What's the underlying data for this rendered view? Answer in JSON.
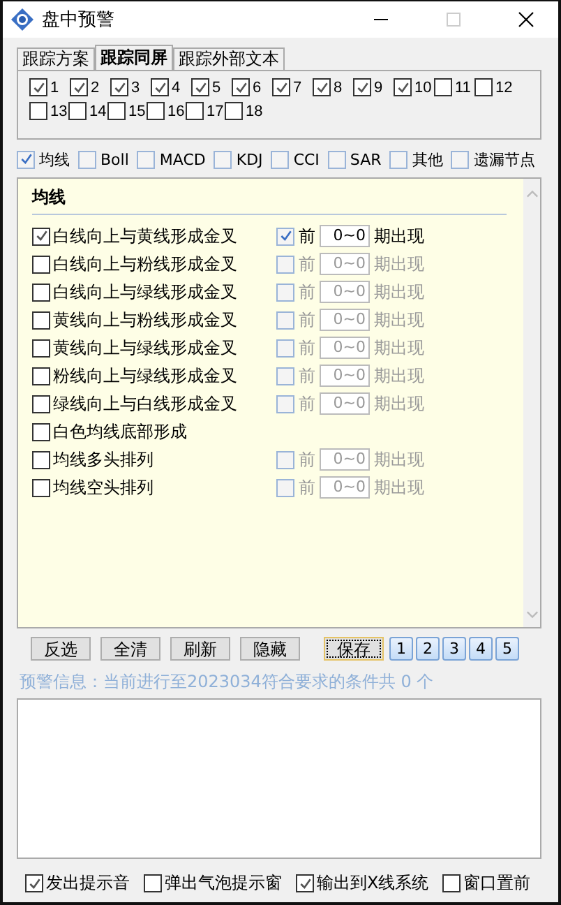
{
  "window": {
    "title": "盘中预警"
  },
  "tabs": [
    {
      "label": "跟踪方案",
      "selected": false
    },
    {
      "label": "跟踪同屏",
      "selected": true
    },
    {
      "label": "跟踪外部文本",
      "selected": false
    }
  ],
  "slots": [
    {
      "label": "1",
      "checked": true
    },
    {
      "label": "2",
      "checked": true
    },
    {
      "label": "3",
      "checked": true
    },
    {
      "label": "4",
      "checked": true
    },
    {
      "label": "5",
      "checked": true
    },
    {
      "label": "6",
      "checked": true
    },
    {
      "label": "7",
      "checked": true
    },
    {
      "label": "8",
      "checked": true
    },
    {
      "label": "9",
      "checked": true
    },
    {
      "label": "10",
      "checked": true
    },
    {
      "label": "11",
      "checked": false
    },
    {
      "label": "12",
      "checked": false
    },
    {
      "label": "13",
      "checked": false
    },
    {
      "label": "14",
      "checked": false
    },
    {
      "label": "15",
      "checked": false
    },
    {
      "label": "16",
      "checked": false
    },
    {
      "label": "17",
      "checked": false
    },
    {
      "label": "18",
      "checked": false
    }
  ],
  "indicators": [
    {
      "label": "均线",
      "checked": true
    },
    {
      "label": "Boll",
      "checked": false
    },
    {
      "label": "MACD",
      "checked": false
    },
    {
      "label": "KDJ",
      "checked": false
    },
    {
      "label": "CCI",
      "checked": false
    },
    {
      "label": "SAR",
      "checked": false
    },
    {
      "label": "其他",
      "checked": false
    },
    {
      "label": "遗漏节点",
      "checked": false
    }
  ],
  "panel": {
    "title": "均线",
    "conditions": [
      {
        "label": "白线向上与黄线形成金叉",
        "checked": true,
        "period": {
          "checked": true,
          "disabled": false,
          "prefix": "前",
          "value": "0~0",
          "suffix": "期出现"
        }
      },
      {
        "label": "白线向上与粉线形成金叉",
        "checked": false,
        "period": {
          "checked": false,
          "disabled": true,
          "prefix": "前",
          "value": "0~0",
          "suffix": "期出现"
        }
      },
      {
        "label": "白线向上与绿线形成金叉",
        "checked": false,
        "period": {
          "checked": false,
          "disabled": true,
          "prefix": "前",
          "value": "0~0",
          "suffix": "期出现"
        }
      },
      {
        "label": "黄线向上与粉线形成金叉",
        "checked": false,
        "period": {
          "checked": false,
          "disabled": true,
          "prefix": "前",
          "value": "0~0",
          "suffix": "期出现"
        }
      },
      {
        "label": "黄线向上与绿线形成金叉",
        "checked": false,
        "period": {
          "checked": false,
          "disabled": true,
          "prefix": "前",
          "value": "0~0",
          "suffix": "期出现"
        }
      },
      {
        "label": "粉线向上与绿线形成金叉",
        "checked": false,
        "period": {
          "checked": false,
          "disabled": true,
          "prefix": "前",
          "value": "0~0",
          "suffix": "期出现"
        }
      },
      {
        "label": "绿线向上与白线形成金叉",
        "checked": false,
        "period": {
          "checked": false,
          "disabled": true,
          "prefix": "前",
          "value": "0~0",
          "suffix": "期出现"
        }
      },
      {
        "label": "白色均线底部形成",
        "checked": false
      },
      {
        "label": "均线多头排列",
        "checked": false,
        "period": {
          "checked": false,
          "disabled": true,
          "prefix": "前",
          "value": "0~0",
          "suffix": "期出现"
        }
      },
      {
        "label": "均线空头排列",
        "checked": false,
        "period": {
          "checked": false,
          "disabled": true,
          "prefix": "前",
          "value": "0~0",
          "suffix": "期出现"
        }
      }
    ]
  },
  "actions": [
    {
      "label": "反选",
      "focused": false
    },
    {
      "label": "全清",
      "focused": false
    },
    {
      "label": "刷新",
      "focused": false
    },
    {
      "label": "隐藏",
      "focused": false
    },
    {
      "label": "保存",
      "focused": true
    }
  ],
  "pages": [
    "1",
    "2",
    "3",
    "4",
    "5"
  ],
  "info": "预警信息：当前进行至2023034符合要求的条件共 0 个",
  "options": [
    {
      "label": "发出提示音",
      "checked": true
    },
    {
      "label": "弹出气泡提示窗",
      "checked": false
    },
    {
      "label": "输出到X线系统",
      "checked": true
    },
    {
      "label": "窗口置前",
      "checked": false
    }
  ]
}
